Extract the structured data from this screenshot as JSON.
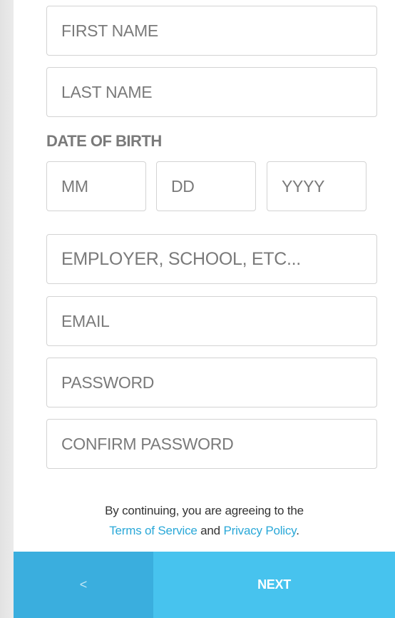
{
  "form": {
    "first_name": {
      "value": "",
      "placeholder": "FIRST NAME"
    },
    "last_name": {
      "value": "",
      "placeholder": "LAST NAME"
    },
    "dob": {
      "label": "DATE OF BIRTH",
      "month": {
        "value": "",
        "placeholder": "MM"
      },
      "day": {
        "value": "",
        "placeholder": "DD"
      },
      "year": {
        "value": "",
        "placeholder": "YYYY"
      }
    },
    "employer": {
      "value": "",
      "placeholder": "EMPLOYER, SCHOOL, ETC..."
    },
    "email": {
      "value": "",
      "placeholder": "EMAIL"
    },
    "password": {
      "value": "",
      "placeholder": "PASSWORD"
    },
    "confirm_password": {
      "value": "",
      "placeholder": "CONFIRM PASSWORD"
    }
  },
  "legal": {
    "line1": "By continuing, you are agreeing to the",
    "terms_link": "Terms of Service",
    "and": "and",
    "privacy_link": "Privacy Policy",
    "period": "."
  },
  "nav": {
    "back_label": "<",
    "next_label": "NEXT"
  },
  "colors": {
    "accent": "#47c3ee",
    "accent_dark": "#3aaede",
    "link": "#2aa8d8"
  }
}
